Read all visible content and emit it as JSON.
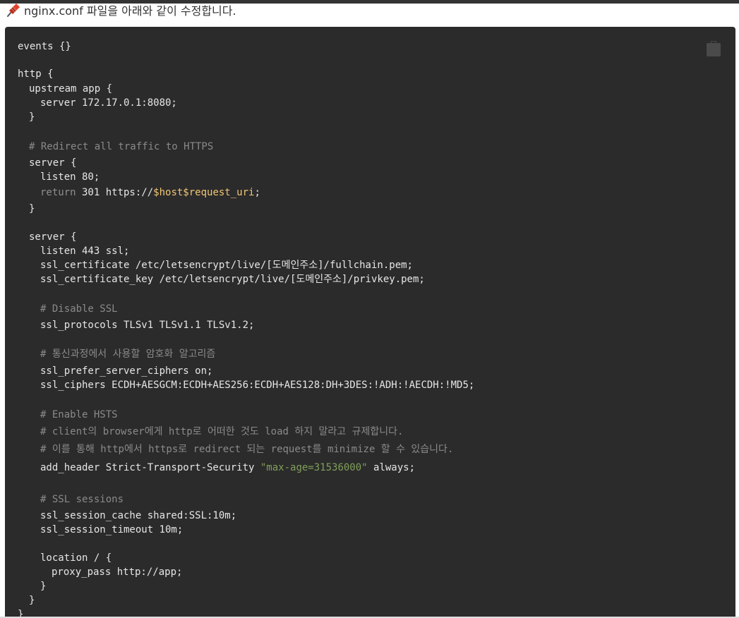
{
  "intro": {
    "text": "nginx.conf 파일을 아래와 같이 수정합니다."
  },
  "colors": {
    "code_background": "#2b2b2b",
    "code_text": "#e6e6e6",
    "comment": "#8a8a8a",
    "variable": "#f0c674",
    "string": "#7f9f5a",
    "pin": "#d23a1f"
  },
  "icons": {
    "pin": "pushpin-icon",
    "copy": "clipboard-icon"
  },
  "code": {
    "l01": "events {}",
    "l02": "http {",
    "l03": "upstream app {",
    "l04": "server 172.17.0.1:8080;",
    "l05": "}",
    "l06": "# Redirect all traffic to HTTPS",
    "l07": "server {",
    "l08": "listen 80;",
    "l09_kw": "return",
    "l09_a": " 301 https://",
    "l09_var": "$host$request_uri",
    "l09_b": ";",
    "l10": "}",
    "l11": "server {",
    "l12": "listen 443 ssl;",
    "l13": "ssl_certificate /etc/letsencrypt/live/[도메인주소]/fullchain.pem;",
    "l14": "ssl_certificate_key /etc/letsencrypt/live/[도메인주소]/privkey.pem;",
    "l15": "# Disable SSL",
    "l16": "ssl_protocols TLSv1 TLSv1.1 TLSv1.2;",
    "l17": "# 통신과정에서 사용할 암호화 알고리즘",
    "l18": "ssl_prefer_server_ciphers on;",
    "l19": "ssl_ciphers ECDH+AESGCM:ECDH+AES256:ECDH+AES128:DH+3DES:!ADH:!AECDH:!MD5;",
    "l20": "# Enable HSTS",
    "l21": "# client의 browser에게 http로 어떠한 것도 load 하지 말라고 규제합니다.",
    "l22": "# 이를 통해 http에서 https로 redirect 되는 request를 minimize 할 수 있습니다.",
    "l23_a": "add_header Strict-Transport-Security ",
    "l23_str": "\"max-age=31536000\"",
    "l23_b": " always;",
    "l24": "# SSL sessions",
    "l25": "ssl_session_cache shared:SSL:10m;",
    "l26": "ssl_session_timeout 10m;",
    "l27": "location / {",
    "l28": "proxy_pass http://app;",
    "l29": "}",
    "l30": "}",
    "l31": "}"
  }
}
